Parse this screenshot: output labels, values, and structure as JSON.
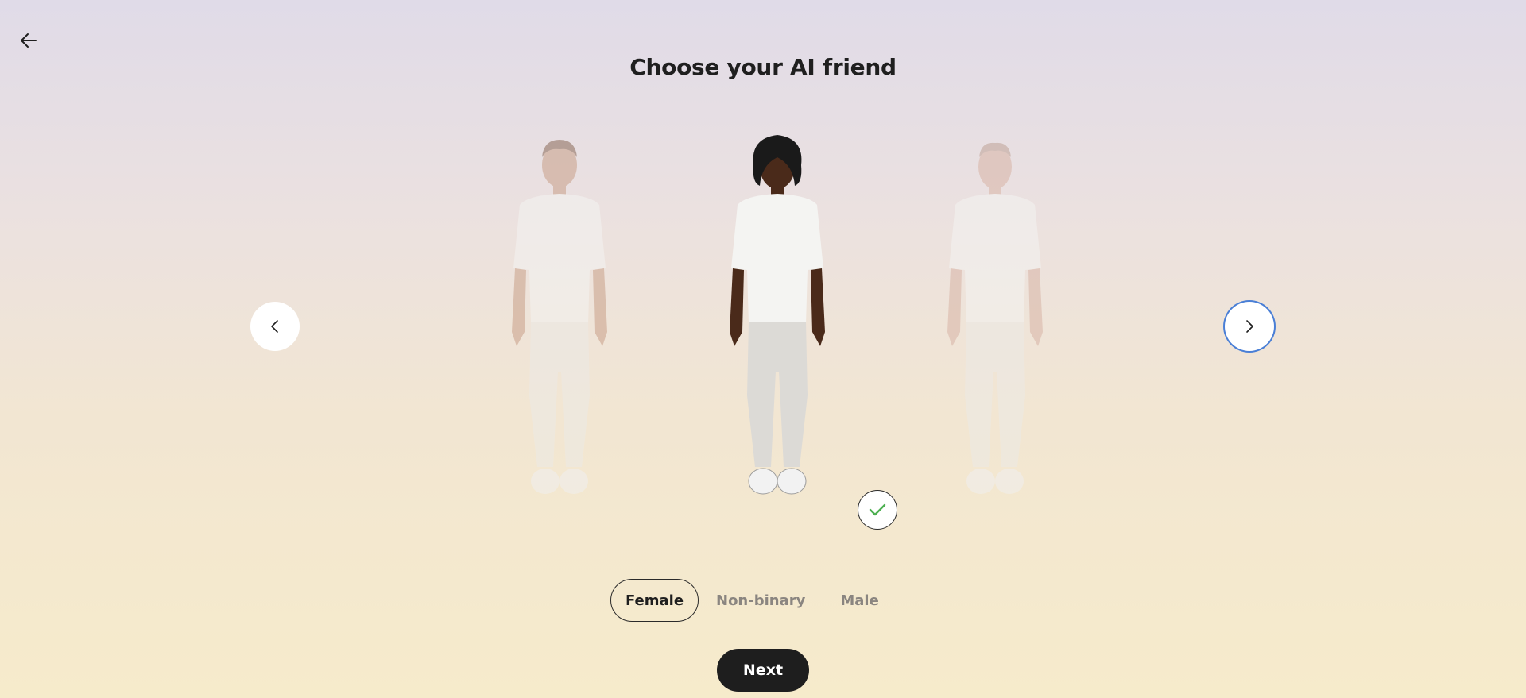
{
  "header": {
    "back_icon": "arrow-left-icon",
    "title": "Choose your AI friend"
  },
  "carousel": {
    "prev_icon": "chevron-left-icon",
    "next_icon": "chevron-right-icon",
    "selected_index": 1,
    "selected_badge_icon": "checkmark-icon",
    "check_color": "#4caf50"
  },
  "gender": {
    "options": [
      "Female",
      "Non-binary",
      "Male"
    ],
    "selected": "Female"
  },
  "footer": {
    "next_label": "Next"
  },
  "colors": {
    "accent_focus": "#4a7fd6",
    "primary_button": "#1e1e1e"
  }
}
